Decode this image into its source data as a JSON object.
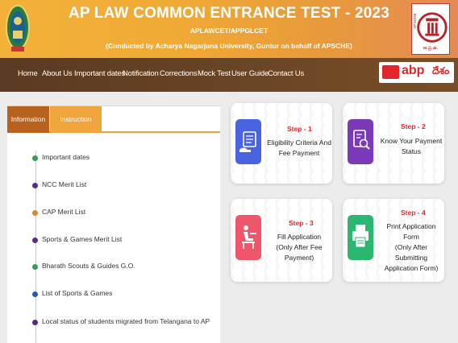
{
  "header": {
    "title": "AP LAW COMMON ENTRANCE TEST - 2023",
    "subtitle1": "APLAWCET/APPGLCET",
    "subtitle2": "(Conducted by Acharya Nagarjuna University, Guntur on behalf of APSCHE)"
  },
  "nav": {
    "items": [
      "Home",
      "About Us",
      "Important dates",
      "Notification",
      "Corrections",
      "Mock Test",
      "User Guide",
      "Contact Us"
    ]
  },
  "watermark": {
    "abp": "abp",
    "desam": "దేశం"
  },
  "emblem": {
    "apsche_letters": "APSCHE",
    "apsche_telugu": "ఆ.ప్ర.ఉ."
  },
  "tabs": {
    "information": "Information",
    "instruction": "Instruction Booklet"
  },
  "info_list": [
    {
      "label": "Important dates",
      "dot_color": "#3a9a5a"
    },
    {
      "label": "NCC Merit List",
      "dot_color": "#5a2a8a"
    },
    {
      "label": "CAP Merit List",
      "dot_color": "#d88a2a"
    },
    {
      "label": "Sports & Games Merit List",
      "dot_color": "#5a2a8a"
    },
    {
      "label": "Bharath Scouts & Guides G.O.",
      "dot_color": "#3a9a5a"
    },
    {
      "label": "List of Sports & Games",
      "dot_color": "#2a5aa8"
    },
    {
      "label": "Local status of students migrated from Telangana to AP",
      "dot_color": "#5a2a8a"
    }
  ],
  "steps": [
    {
      "step": "Step - 1",
      "lines": [
        "Eligibility Criteria And",
        "Fee Payment"
      ],
      "color": "#4a63e0"
    },
    {
      "step": "Step - 2",
      "lines": [
        "Know Your Payment",
        "Status"
      ],
      "color": "#7a3ab8"
    },
    {
      "step": "Step - 3",
      "lines": [
        "Fill Application",
        "(Only After Fee",
        "Payment)"
      ],
      "color": "#f0566a"
    },
    {
      "step": "Step - 4",
      "lines": [
        "Print Application Form",
        "(Only After Submitting",
        "Application Form)"
      ],
      "color": "#2ab870"
    }
  ]
}
